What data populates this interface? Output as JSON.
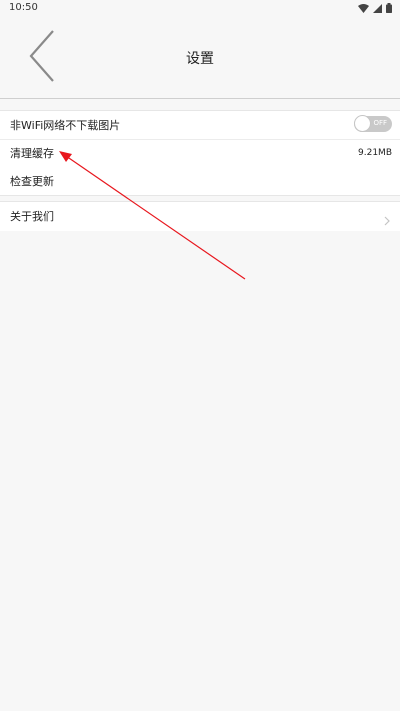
{
  "status_bar": {
    "time": "10:50",
    "icons": [
      "wifi-icon",
      "signal-icon",
      "battery-icon"
    ]
  },
  "header": {
    "title": "设置",
    "back_icon": "chevron-left-icon"
  },
  "settings": {
    "no_image_on_mobile": {
      "label": "非WiFi网络不下载图片",
      "toggle_state": "OFF"
    },
    "clear_cache": {
      "label": "清理缓存",
      "value": "9.21MB"
    },
    "check_update": {
      "label": "检查更新"
    },
    "about_us": {
      "label": "关于我们",
      "icon": "chevron-right-icon"
    }
  },
  "colors": {
    "background": "#f7f7f7",
    "row_background": "#ffffff",
    "toggle_off": "#c9c9c9",
    "annotation_arrow": "#e8171e"
  }
}
